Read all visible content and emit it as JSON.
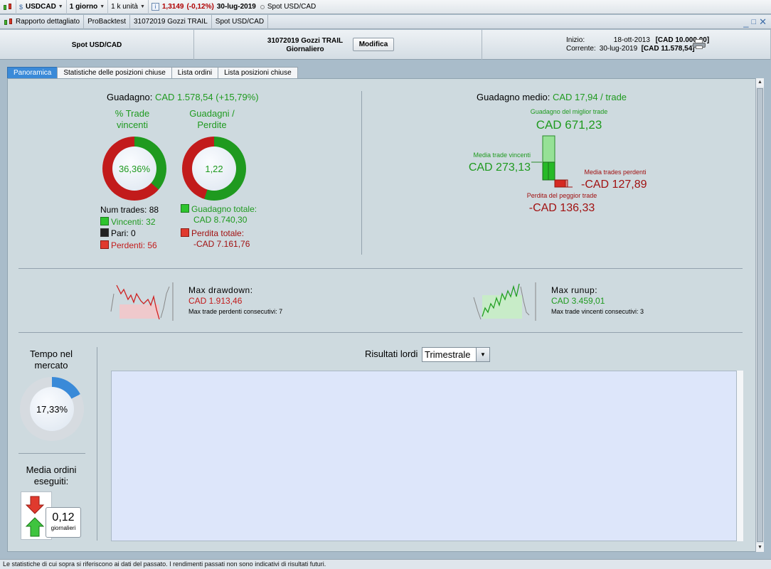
{
  "toolbar": {
    "symbol": "USDCAD",
    "timeframe": "1 giorno",
    "units": "1 k unità",
    "price": "1,3149",
    "change": "(-0,12%)",
    "date": "30-lug-2019",
    "instrument": "Spot USD/CAD",
    "info_icon_letter": "i"
  },
  "window_tabs": [
    "Rapporto dettagliato",
    "ProBacktest",
    "31072019 Gozzi TRAIL",
    "Spot USD/CAD"
  ],
  "header": {
    "spot": "Spot USD/CAD",
    "strategy_name": "31072019 Gozzi TRAIL",
    "period": "Giornaliero",
    "modify_button": "Modifica",
    "start_label": "Inizio:",
    "start_date": "18-ott-2013",
    "start_capital": "[CAD 10.000,00]",
    "current_label": "Corrente:",
    "current_date": "30-lug-2019",
    "current_capital": "[CAD 11.578,54]"
  },
  "content_tabs": [
    "Panoramica",
    "Statistiche delle posizioni chiuse",
    "Lista ordini",
    "Lista posizioni chiuse"
  ],
  "summary": {
    "gain_label": "Guadagno:",
    "gain_value": "CAD 1.578,54 (+15,79%)",
    "win_pct_title_1": "% Trade",
    "win_pct_title_2": "vincenti",
    "win_pct_value": "36,36%",
    "win_pct_fraction": 0.3636,
    "gl_title_1": "Guadagni /",
    "gl_title_2": "Perdite",
    "gl_value": "1,22",
    "num_trades": "Num trades: 88",
    "winners": "Vincenti: 32",
    "even": "Pari: 0",
    "losers": "Perdenti: 56",
    "total_gain_label": "Guadagno totale:",
    "total_gain_value": "CAD 8.740,30",
    "total_loss_label": "Perdita totale:",
    "total_loss_value": "-CAD 7.161,76"
  },
  "average": {
    "title": "Guadagno medio:",
    "value": "CAD 17,94 / trade",
    "best_label": "Guadagno del miglior trade",
    "best_value": "CAD 671,23",
    "avg_win_label": "Media trade vincenti",
    "avg_win_value": "CAD 273,13",
    "avg_loss_label": "Media trades perdenti",
    "avg_loss_value": "-CAD 127,89",
    "worst_label": "Perdita del peggior trade",
    "worst_value": "-CAD 136,33"
  },
  "drawdown": {
    "title": "Max drawdown:",
    "value": "CAD 1.913,46",
    "sub": "Max trade perdenti consecutivi: 7"
  },
  "runup": {
    "title": "Max runup:",
    "value": "CAD 3.459,01",
    "sub": "Max trade vincenti consecutivi: 3"
  },
  "market_time": {
    "title_1": "Tempo nel",
    "title_2": "mercato",
    "value": "17,33%",
    "fraction": 0.1733
  },
  "orders": {
    "title_1": "Media ordini",
    "title_2": "eseguiti:",
    "value": "0,12",
    "unit": "giornalieri"
  },
  "results": {
    "label": "Risultati lordi",
    "period": "Trimestrale"
  },
  "status": "Le statistiche di cui sopra si riferiscono ai dati del passato. I rendimenti passati non sono indicativi di risultati futuri.",
  "colors": {
    "win": "#1f9a1f",
    "loss": "#c21b1b",
    "accent": "#3a8ad8"
  }
}
